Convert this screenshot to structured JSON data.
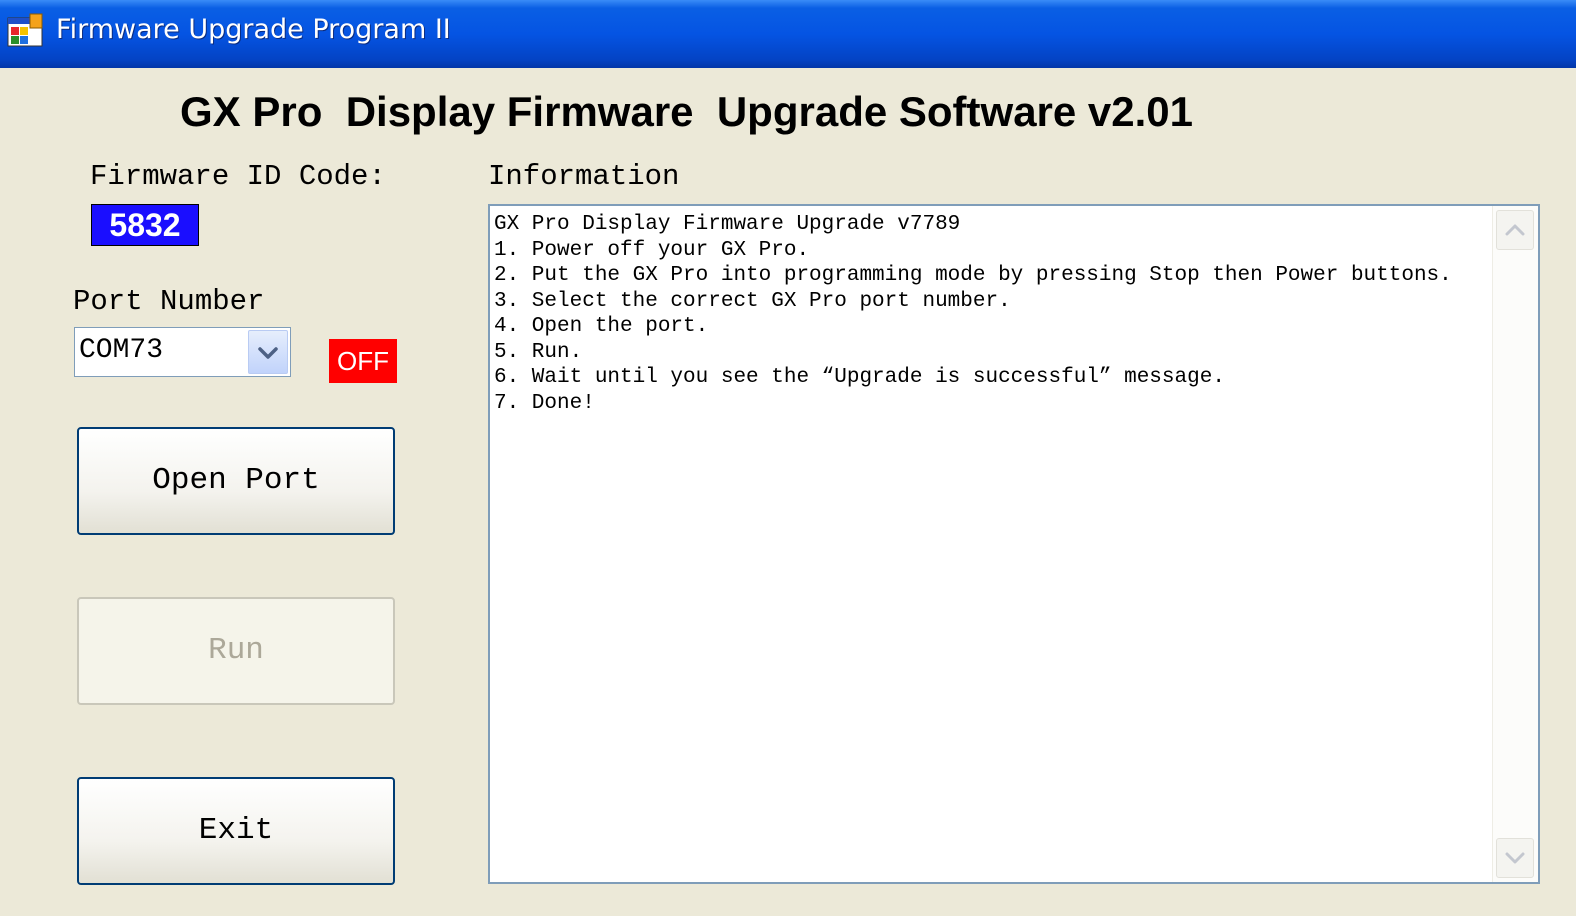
{
  "window": {
    "title": "Firmware Upgrade Program II"
  },
  "heading": "GX Pro  Display Firmware  Upgrade Software v2.01",
  "firmware": {
    "label": "Firmware ID Code:",
    "code": "5832"
  },
  "port": {
    "label": "Port Number",
    "selected": "COM73",
    "status": "OFF"
  },
  "buttons": {
    "open_port": "Open Port",
    "run": "Run",
    "exit": "Exit"
  },
  "information": {
    "label": "Information",
    "lines": [
      "GX Pro Display Firmware Upgrade v7789",
      "1. Power off your GX Pro.",
      "2. Put the GX Pro into programming mode by pressing Stop then Power buttons.",
      "3. Select the correct GX Pro port number.",
      "4. Open the port.",
      "5. Run.",
      "6. Wait until you see the “Upgrade is successful” message.",
      "7. Done!"
    ]
  },
  "colors": {
    "titlebar": "#0554e3",
    "firmware_code_bg": "#1a0eff",
    "status_off_bg": "#ff0000",
    "window_bg": "#ece9d8"
  },
  "icons": {
    "app": "app-window-icon",
    "combo": "chevron-down-icon",
    "scroll_up": "chevron-up-icon",
    "scroll_down": "chevron-down-icon"
  }
}
